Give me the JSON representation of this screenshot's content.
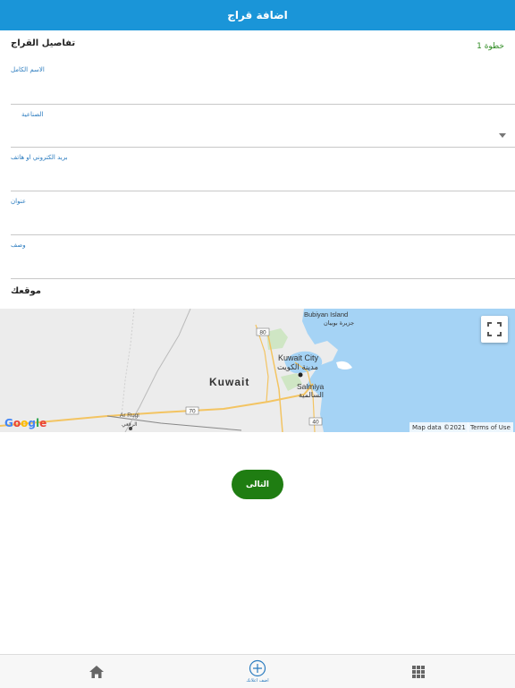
{
  "header": {
    "title": "اضافة قراج"
  },
  "form": {
    "section_title": "تفاصيل القراج",
    "step": "خطوة 1",
    "fields": [
      {
        "label": "الاسم الكامل",
        "value": ""
      },
      {
        "label": "الصناعية",
        "value": ""
      },
      {
        "label": "بريد الكتروني او هاتف",
        "value": ""
      },
      {
        "label": "عنوان",
        "value": ""
      },
      {
        "label": "وصف",
        "value": ""
      }
    ]
  },
  "location": {
    "title": "موقعك",
    "map": {
      "labels": {
        "bubiyan_en": "Bubiyan Island",
        "bubiyan_ar": "جزيرة بوبيان",
        "kuwait_city_en": "Kuwait City",
        "kuwait_city_ar": "مدينة الكويت",
        "salmiya_en": "Salmiya",
        "salmiya_ar": "السالمية",
        "kuwait": "Kuwait",
        "ar_rugi_en": "Ar Rugi",
        "ar_rugi_ar": "الرقعي",
        "road_80": "80",
        "road_70": "70",
        "road_40": "40"
      },
      "google": "Google",
      "map_data": "Map data ©2021",
      "terms": "Terms of Use",
      "colors": {
        "water": "#a5d3f5",
        "land": "#ececec",
        "road": "#f3c462",
        "park": "#cfe6c4"
      }
    }
  },
  "actions": {
    "next": "التالى"
  },
  "bottom_nav": {
    "home": {
      "icon": "home-icon"
    },
    "add": {
      "icon": "add-circle-icon",
      "label": "اضف اعلانك"
    },
    "menu": {
      "icon": "grid-icon"
    }
  },
  "colors": {
    "primary": "#1a95d8",
    "accent_green": "#1f7d12",
    "step_green": "#2e8b22",
    "label_blue": "#2a7bbf"
  }
}
